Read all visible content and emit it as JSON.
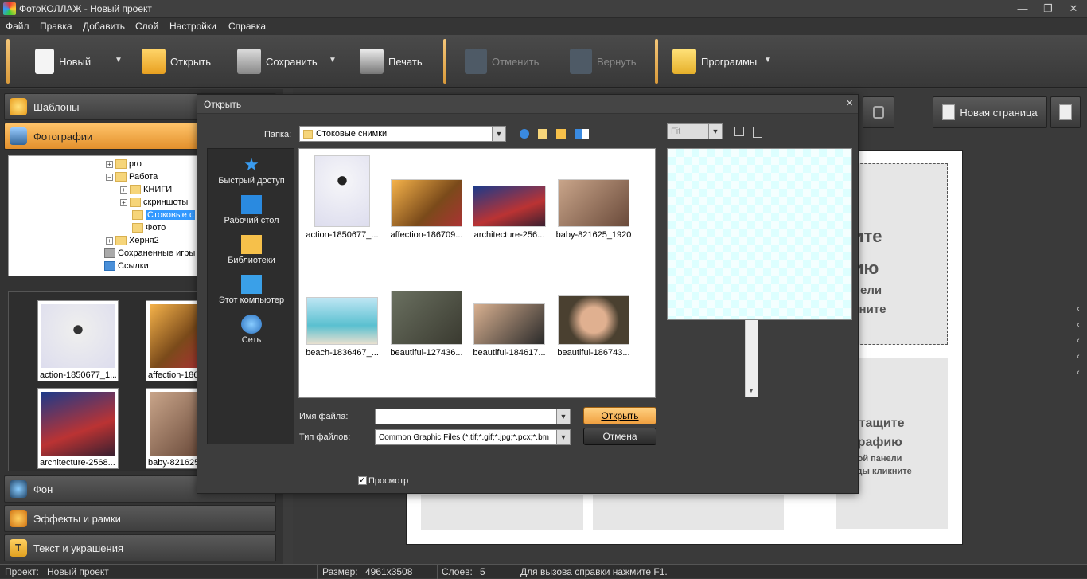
{
  "window": {
    "title": "ФотоКОЛЛАЖ - Новый проект",
    "minimize": "—",
    "restore": "❐",
    "close": "✕"
  },
  "menu": [
    "Файл",
    "Правка",
    "Добавить",
    "Слой",
    "Настройки",
    "Справка"
  ],
  "toolbar": {
    "new": "Новый",
    "open": "Открыть",
    "save": "Сохранить",
    "print": "Печать",
    "undo": "Отменить",
    "redo": "Вернуть",
    "programs": "Программы"
  },
  "left_panel": {
    "templates": "Шаблоны",
    "photos": "Фотографии",
    "background": "Фон",
    "effects": "Эффекты и рамки",
    "text": "Текст и украшения",
    "tree": [
      {
        "label": "pro"
      },
      {
        "label": "Работа"
      },
      {
        "label": "КНИГИ"
      },
      {
        "label": "скриншоты"
      },
      {
        "label": "Стоковые с"
      },
      {
        "label": "Фото"
      },
      {
        "label": "Херня2"
      },
      {
        "label": "Сохраненные игры"
      },
      {
        "label": "Ссылки"
      }
    ],
    "thumbs": [
      {
        "caption": "action-1850677_1..."
      },
      {
        "caption": "affection-186"
      },
      {
        "caption": "architecture-2568..."
      },
      {
        "caption": "baby-821625"
      }
    ]
  },
  "right": {
    "new_page": "Новая страница",
    "hint_top": [
      "ите",
      "ию",
      "пели",
      "кните"
    ],
    "hint_bottom": [
      "етащите",
      "графию",
      "вой панели",
      "кды кликните"
    ]
  },
  "dialog": {
    "title": "Открыть",
    "folder_label": "Папка:",
    "folder_value": "Стоковые снимки",
    "places": [
      "Быстрый доступ",
      "Рабочий стол",
      "Библиотеки",
      "Этот компьютер",
      "Сеть"
    ],
    "files": [
      {
        "name": "action-1850677_..."
      },
      {
        "name": "affection-186709..."
      },
      {
        "name": "architecture-256..."
      },
      {
        "name": "baby-821625_1920"
      },
      {
        "name": "beach-1836467_..."
      },
      {
        "name": "beautiful-127436..."
      },
      {
        "name": "beautiful-184617..."
      },
      {
        "name": "beautiful-186743..."
      }
    ],
    "fit": "Fit",
    "filename_label": "Имя файла:",
    "filename_value": "",
    "filetype_label": "Тип файлов:",
    "filetype_value": "Common Graphic Files (*.tif;*.gif;*.jpg;*.pcx;*.bm",
    "open_btn": "Открыть",
    "cancel_btn": "Отмена",
    "preview_label": "Просмотр",
    "preview_checked": true
  },
  "status": {
    "project_label": "Проект:",
    "project_value": "Новый проект",
    "size_label": "Размер:",
    "size_value": "4961x3508",
    "layers_label": "Слоев:",
    "layers_value": "5",
    "help": "Для вызова справки нажмите F1."
  }
}
